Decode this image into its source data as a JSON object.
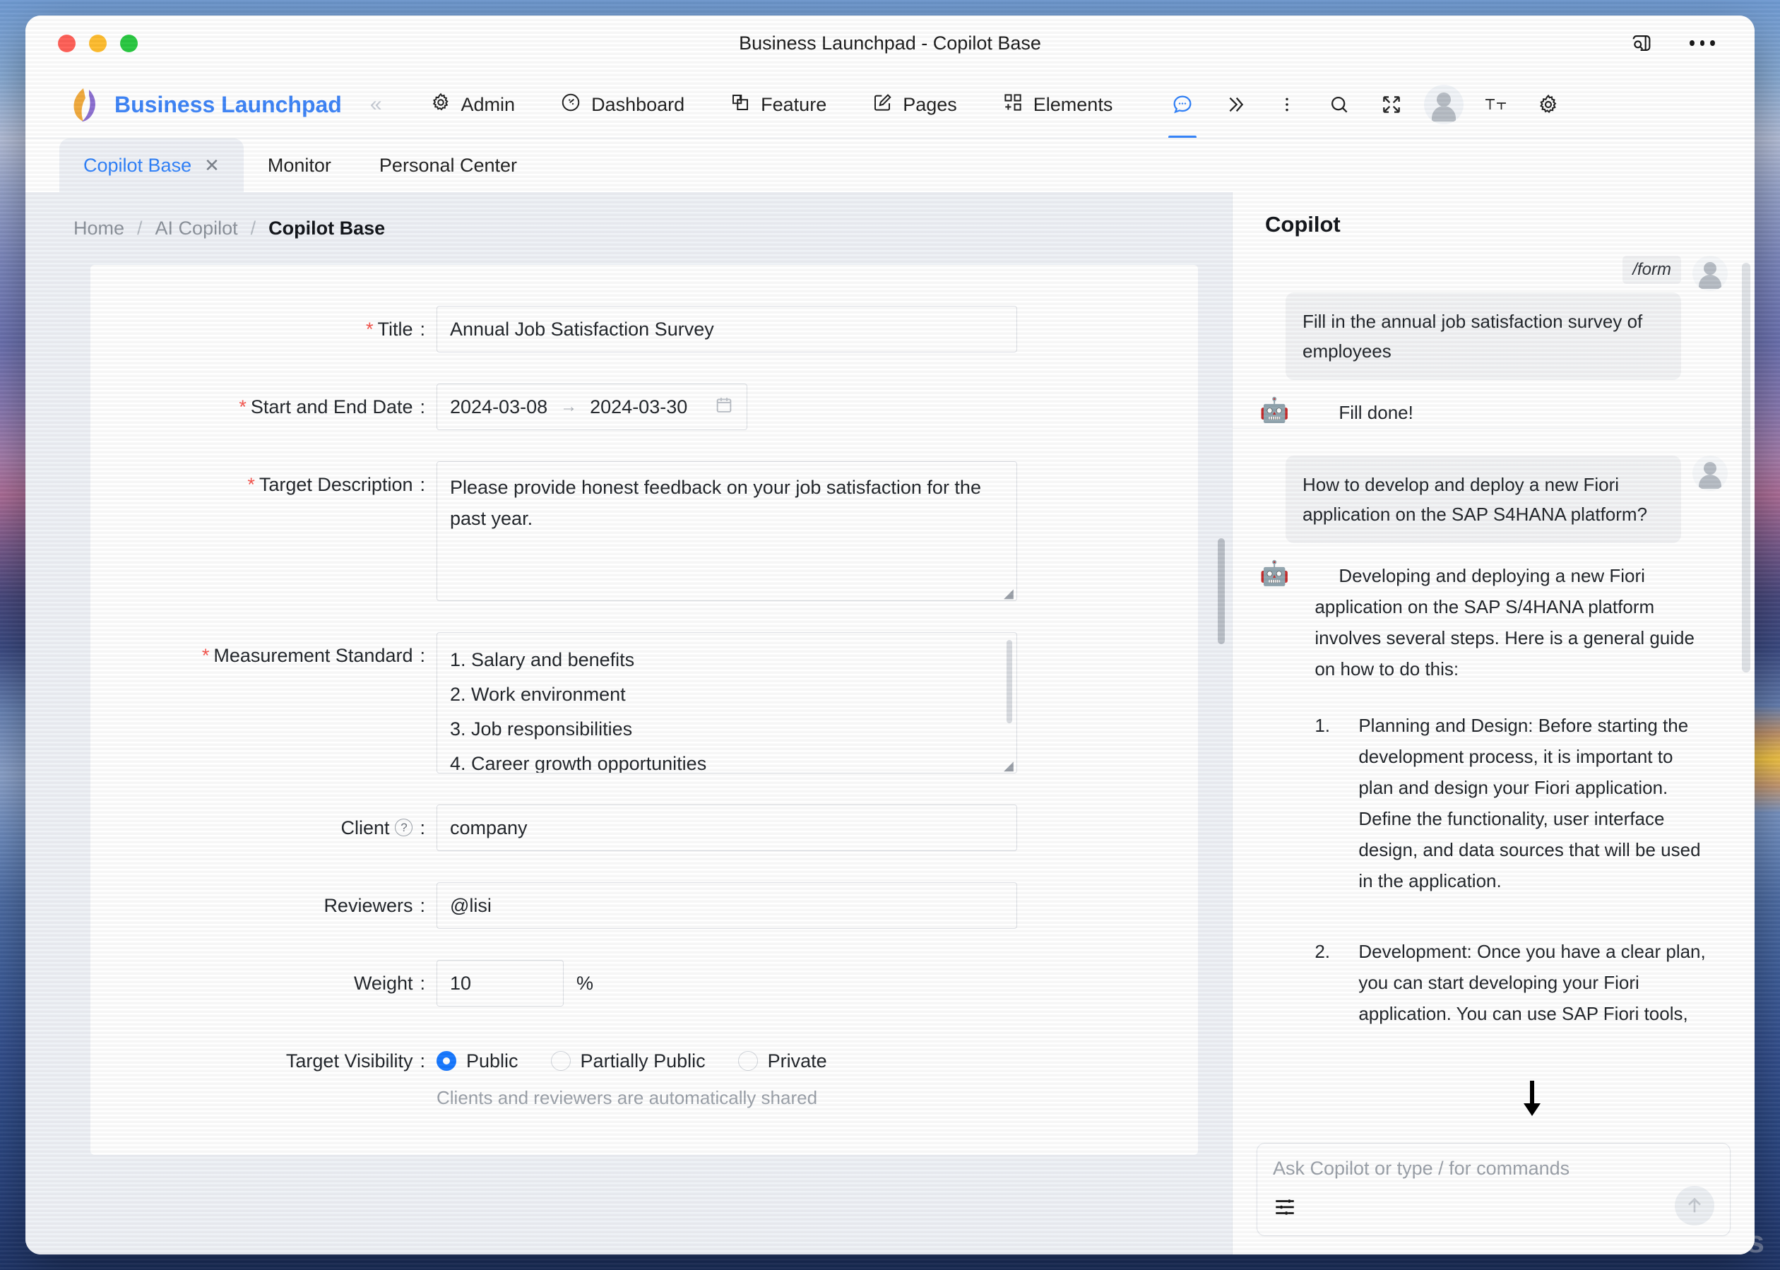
{
  "window": {
    "title": "Business Launchpad - Copilot Base",
    "traffic_lights": [
      "close",
      "minimize",
      "zoom"
    ],
    "right_icons": [
      "sidebar-search-icon",
      "more-options-icon"
    ]
  },
  "topnav": {
    "brand": "Business Launchpad",
    "collapse_icon": "«",
    "items": [
      {
        "label": "Admin",
        "icon": "gear-icon"
      },
      {
        "label": "Dashboard",
        "icon": "gauge-icon"
      },
      {
        "label": "Feature",
        "icon": "layers-icon"
      },
      {
        "label": "Pages",
        "icon": "edit-square-icon"
      },
      {
        "label": "Elements",
        "icon": "grid-add-icon"
      }
    ],
    "tools": [
      {
        "name": "copilot-chat-icon",
        "active": true
      },
      {
        "name": "chevron-double-right-icon",
        "active": false
      },
      {
        "name": "more-vertical-icon",
        "active": false
      },
      {
        "name": "search-icon",
        "active": false
      },
      {
        "name": "fullscreen-icon",
        "active": false
      },
      {
        "name": "user-avatar",
        "active": false
      },
      {
        "name": "text-size-icon",
        "active": false
      },
      {
        "name": "settings-gear-icon",
        "active": false
      }
    ]
  },
  "tabs": [
    {
      "label": "Copilot Base",
      "active": true,
      "closable": true,
      "close_glyph": "✕"
    },
    {
      "label": "Monitor",
      "active": false,
      "closable": false
    },
    {
      "label": "Personal Center",
      "active": false,
      "closable": false
    }
  ],
  "breadcrumb": {
    "items": [
      "Home",
      "AI Copilot",
      "Copilot Base"
    ],
    "separator": "/"
  },
  "form": {
    "title": {
      "label": "Title",
      "required": true,
      "value": "Annual Job Satisfaction Survey"
    },
    "date_range": {
      "label": "Start and End Date",
      "required": true,
      "start": "2024-03-08",
      "end": "2024-03-30",
      "arrow": "→",
      "calendar_icon": "calendar-icon"
    },
    "target_description": {
      "label": "Target Description",
      "required": true,
      "value": "Please provide honest feedback on your job satisfaction for the past year."
    },
    "measurement_standard": {
      "label": "Measurement Standard",
      "required": true,
      "lines": [
        "1. Salary and benefits",
        "2. Work environment",
        "3. Job responsibilities",
        "4. Career growth opportunities"
      ]
    },
    "client": {
      "label": "Client",
      "required": false,
      "help_icon": "question-mark-icon",
      "help_glyph": "?",
      "value": "company"
    },
    "reviewers": {
      "label": "Reviewers",
      "required": false,
      "value": "@lisi"
    },
    "weight": {
      "label": "Weight",
      "required": false,
      "value": "10",
      "unit": "%"
    },
    "target_visibility": {
      "label": "Target Visibility",
      "required": false,
      "options": [
        {
          "label": "Public",
          "selected": true
        },
        {
          "label": "Partially Public",
          "selected": false
        },
        {
          "label": "Private",
          "selected": false
        }
      ],
      "hint": "Clients and reviewers are automatically shared"
    }
  },
  "copilot": {
    "title": "Copilot",
    "conversations": [
      {
        "command_chip": "/form",
        "user_message": "Fill in the annual job satisfaction survey of employees",
        "bot_avatar": "🤖",
        "bot_paragraphs": [
          "Fill done!"
        ],
        "bot_list": []
      },
      {
        "command_chip": null,
        "user_message": "How to develop and deploy a new Fiori application on the SAP S4HANA platform?",
        "bot_avatar": "🤖",
        "bot_paragraphs": [
          "Developing and deploying a new Fiori application on the SAP S/4HANA platform involves several steps. Here is a general guide on how to do this:"
        ],
        "bot_list": [
          {
            "num": "1.",
            "text": "Planning and Design: Before starting the development process, it is important to plan and design your Fiori application. Define the functionality, user interface design, and data sources that will be used in the application."
          },
          {
            "num": "2.",
            "text": "Development: Once you have a clear plan, you can start developing your Fiori application. You can use SAP Fiori tools,"
          }
        ]
      }
    ],
    "composer": {
      "placeholder": "Ask Copilot or type / for commands",
      "settings_icon": "sliders-icon",
      "send_icon": "arrow-up-icon"
    }
  },
  "wallpaper": {
    "watermark": "cros"
  },
  "colors": {
    "brand_blue": "#3b82f6",
    "accent_blue": "#2d7ff9",
    "radio_blue": "#1677ff",
    "required_red": "#f5544c",
    "panel_bg": "#eef1f6"
  }
}
